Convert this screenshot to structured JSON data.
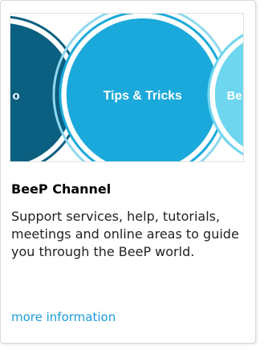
{
  "card": {
    "banner": {
      "left_label": "o",
      "center_label": "Tips & Tricks",
      "right_label": "Be"
    },
    "title": "BeeP Channel",
    "description": "Support services, help, tutorials, meetings and online areas to guide you through the BeeP world.",
    "link_label": "more information"
  },
  "colors": {
    "accent_link": "#1a9ad6",
    "dark_teal": "#0b5f80",
    "circle_blue": "#1aa9da",
    "light_cyan": "#6fd6f0"
  }
}
